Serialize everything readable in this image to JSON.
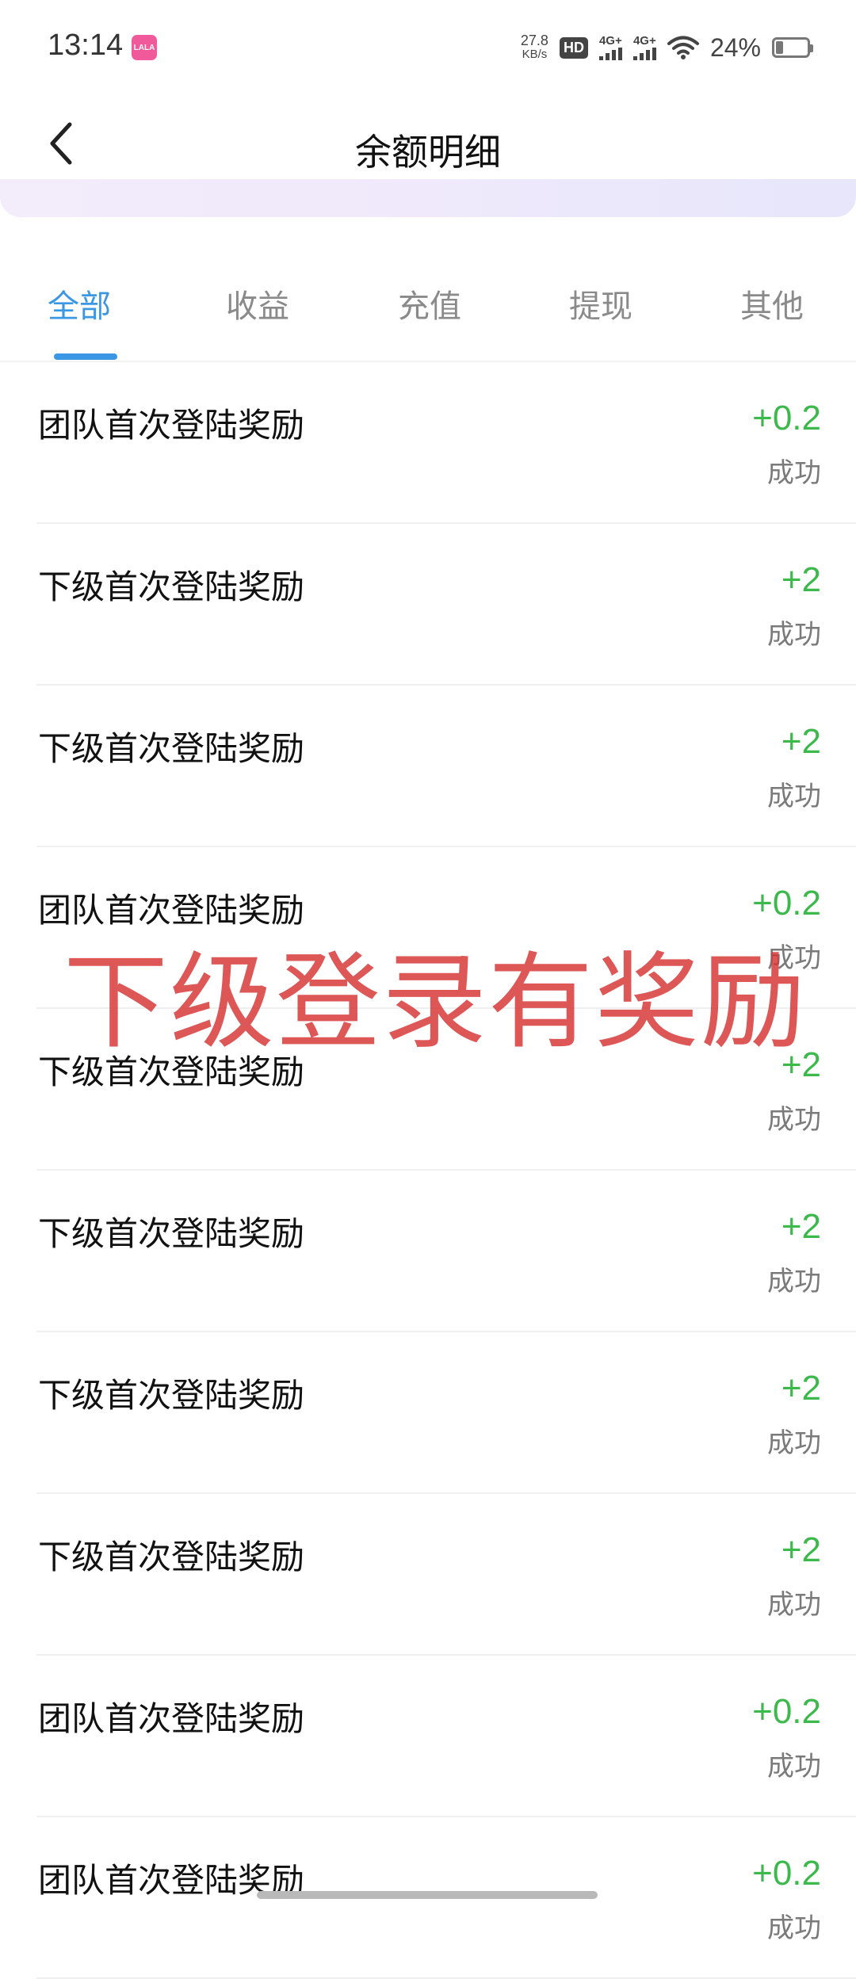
{
  "status_bar": {
    "time": "13:14",
    "app_icon_text": "LALA",
    "net_speed": "27.8",
    "net_speed_unit": "KB/s",
    "hd_badge": "HD",
    "signal_1": "4G+",
    "signal_2": "4G+",
    "battery_percent": "24%",
    "battery_level": 0.24,
    "app_icon_color": "#f05a9a"
  },
  "header": {
    "back_icon": "chevron-left-icon",
    "title": "余额明细"
  },
  "tabs": [
    {
      "label": "全部",
      "active": true
    },
    {
      "label": "收益",
      "active": false
    },
    {
      "label": "充值",
      "active": false
    },
    {
      "label": "提现",
      "active": false
    },
    {
      "label": "其他",
      "active": false
    }
  ],
  "transactions": [
    {
      "title": "团队首次登陆奖励",
      "amount": "+0.2",
      "status": "成功"
    },
    {
      "title": "下级首次登陆奖励",
      "amount": "+2",
      "status": "成功"
    },
    {
      "title": "下级首次登陆奖励",
      "amount": "+2",
      "status": "成功"
    },
    {
      "title": "团队首次登陆奖励",
      "amount": "+0.2",
      "status": "成功"
    },
    {
      "title": "下级首次登陆奖励",
      "amount": "+2",
      "status": "成功"
    },
    {
      "title": "下级首次登陆奖励",
      "amount": "+2",
      "status": "成功"
    },
    {
      "title": "下级首次登陆奖励",
      "amount": "+2",
      "status": "成功"
    },
    {
      "title": "下级首次登陆奖励",
      "amount": "+2",
      "status": "成功"
    },
    {
      "title": "团队首次登陆奖励",
      "amount": "+0.2",
      "status": "成功"
    },
    {
      "title": "团队首次登陆奖励",
      "amount": "+0.2",
      "status": "成功"
    }
  ],
  "watermark": "下级登录有奖励",
  "colors": {
    "accent": "#3b97e3",
    "amount_positive": "#3cb94b",
    "watermark": "#d63232"
  }
}
